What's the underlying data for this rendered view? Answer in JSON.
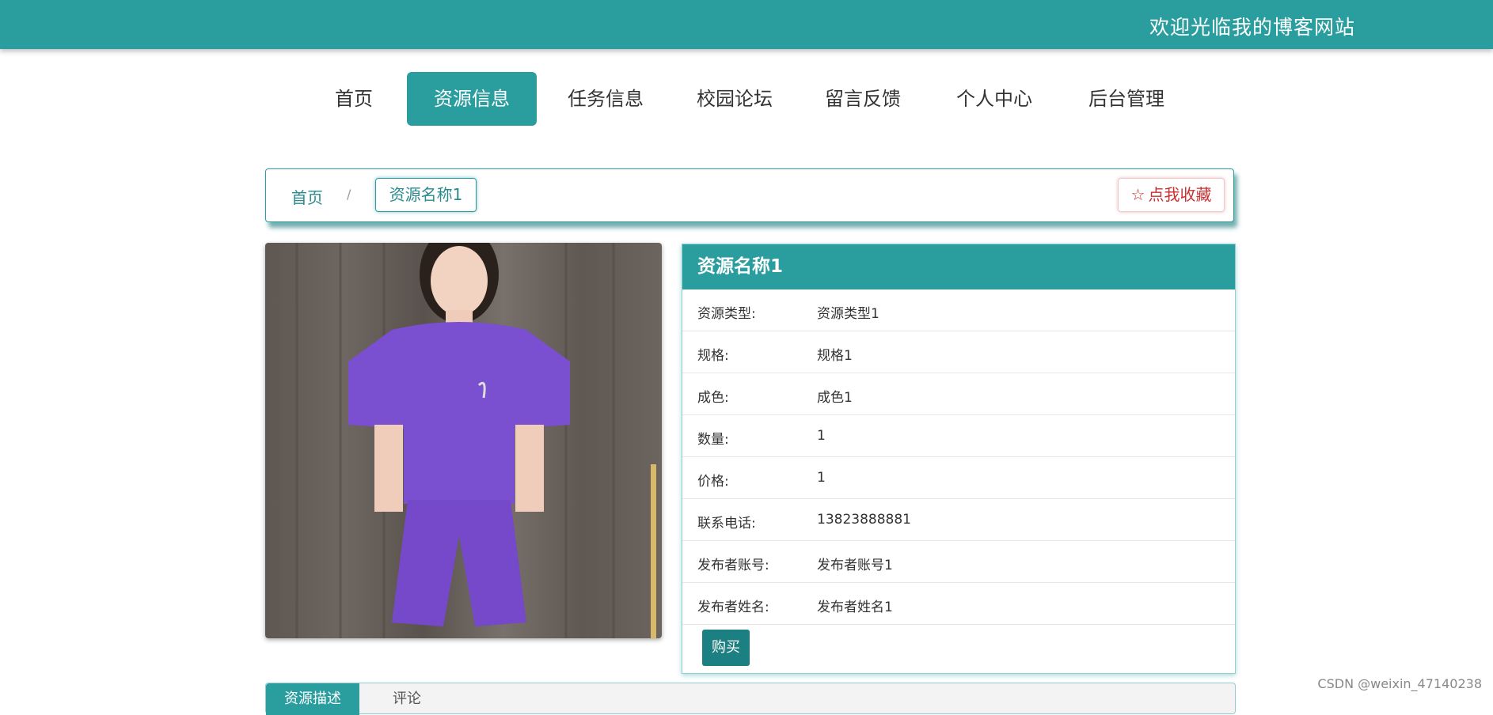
{
  "header": {
    "welcome_text": "欢迎光临我的博客网站"
  },
  "nav": {
    "items": [
      {
        "label": "首页"
      },
      {
        "label": "资源信息"
      },
      {
        "label": "任务信息"
      },
      {
        "label": "校园论坛"
      },
      {
        "label": "留言反馈"
      },
      {
        "label": "个人中心"
      },
      {
        "label": "后台管理"
      }
    ],
    "active_index": 1
  },
  "breadcrumb": {
    "home": "首页",
    "separator": "/",
    "current": "资源名称1"
  },
  "favorite": {
    "icon": "star-outline-icon",
    "label": "点我收藏"
  },
  "product": {
    "image_alt": "product photo",
    "title": "资源名称1",
    "fields": [
      {
        "label": "资源类型:",
        "value": "资源类型1"
      },
      {
        "label": "规格:",
        "value": "规格1"
      },
      {
        "label": "成色:",
        "value": "成色1"
      },
      {
        "label": "数量:",
        "value": "1"
      },
      {
        "label": "价格:",
        "value": "1"
      },
      {
        "label": "联系电话:",
        "value": "13823888881"
      },
      {
        "label": "发布者账号:",
        "value": "发布者账号1"
      },
      {
        "label": "发布者姓名:",
        "value": "发布者姓名1"
      }
    ],
    "buy_label": "购买"
  },
  "tabs": [
    {
      "label": "资源描述"
    },
    {
      "label": "评论"
    }
  ],
  "watermark": "CSDN @weixin_47140238",
  "colors": {
    "accent": "#2a9d9f",
    "buy": "#1c7f81",
    "favorite": "#c83232"
  }
}
